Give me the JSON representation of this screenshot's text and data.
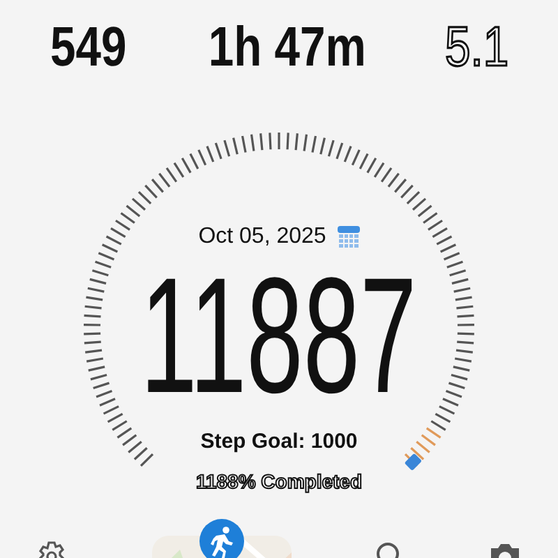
{
  "stats": [
    {
      "value": "549",
      "outlined": false
    },
    {
      "value": "1h 47m",
      "outlined": false
    },
    {
      "value": "5.1",
      "outlined": true
    }
  ],
  "gauge": {
    "date": "Oct 05, 2025",
    "steps": "11887",
    "goal": "Step Goal: 1000",
    "completed": "1188% Completed"
  },
  "nav": {
    "items": [
      {
        "kind": "settings"
      },
      {
        "kind": "run"
      },
      {
        "kind": "search"
      },
      {
        "kind": "camera"
      }
    ]
  }
}
